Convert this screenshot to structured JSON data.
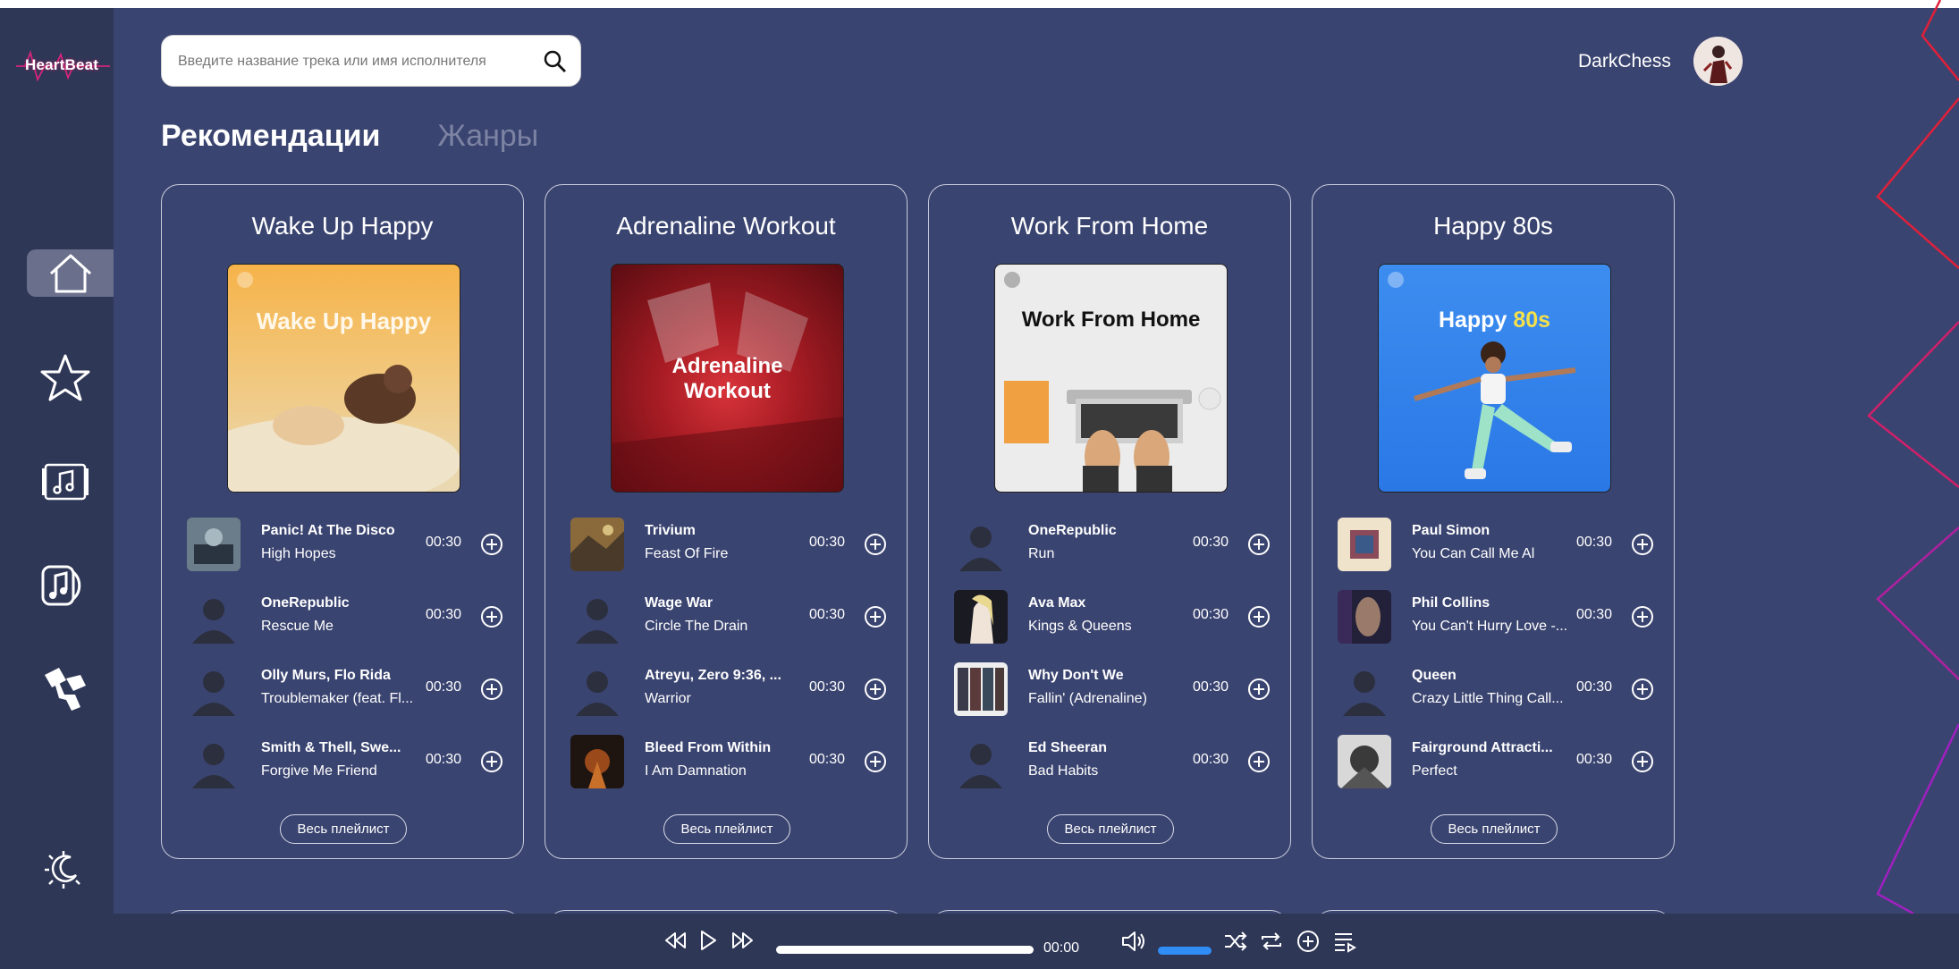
{
  "app": {
    "name": "HeartBeat"
  },
  "search": {
    "placeholder": "Введите название трека или имя исполнителя"
  },
  "user": {
    "name": "DarkChess"
  },
  "tabs": [
    {
      "label": "Рекомендации",
      "active": true
    },
    {
      "label": "Жанры",
      "active": false
    }
  ],
  "sidebar": {
    "items": [
      "home-icon",
      "star-icon",
      "music-album-icon",
      "music-note-icon",
      "microphone-icon",
      "theme-toggle-icon"
    ]
  },
  "playlists": [
    {
      "title": "Wake Up Happy",
      "cover_text": "Wake Up Happy",
      "tracks": [
        {
          "artist": "Panic! At The Disco",
          "song": "High Hopes",
          "duration": "00:30"
        },
        {
          "artist": "OneRepublic",
          "song": "Rescue Me",
          "duration": "00:30"
        },
        {
          "artist": "Olly Murs, Flo Rida",
          "song": "Troublemaker (feat. Fl...",
          "duration": "00:30"
        },
        {
          "artist": "Smith & Thell, Swe...",
          "song": "Forgive Me Friend",
          "duration": "00:30"
        }
      ],
      "button": "Весь плейлист"
    },
    {
      "title": "Adrenaline Workout",
      "cover_text": "Adrenaline Workout",
      "tracks": [
        {
          "artist": "Trivium",
          "song": "Feast Of Fire",
          "duration": "00:30"
        },
        {
          "artist": "Wage War",
          "song": "Circle The Drain",
          "duration": "00:30"
        },
        {
          "artist": "Atreyu, Zero 9:36, ...",
          "song": "Warrior",
          "duration": "00:30"
        },
        {
          "artist": "Bleed From Within",
          "song": "I Am Damnation",
          "duration": "00:30"
        }
      ],
      "button": "Весь плейлист"
    },
    {
      "title": "Work From Home",
      "cover_text": "Work From Home",
      "tracks": [
        {
          "artist": "OneRepublic",
          "song": "Run",
          "duration": "00:30"
        },
        {
          "artist": "Ava Max",
          "song": "Kings & Queens",
          "duration": "00:30"
        },
        {
          "artist": "Why Don't We",
          "song": "Fallin' (Adrenaline)",
          "duration": "00:30"
        },
        {
          "artist": "Ed Sheeran",
          "song": "Bad Habits",
          "duration": "00:30"
        }
      ],
      "button": "Весь плейлист"
    },
    {
      "title": "Happy 80s",
      "cover_text_a": "Happy",
      "cover_text_b": "80s",
      "tracks": [
        {
          "artist": "Paul Simon",
          "song": "You Can Call Me Al",
          "duration": "00:30"
        },
        {
          "artist": "Phil Collins",
          "song": "You Can't Hurry Love -...",
          "duration": "00:30"
        },
        {
          "artist": "Queen",
          "song": "Crazy Little Thing Call...",
          "duration": "00:30"
        },
        {
          "artist": "Fairground Attracti...",
          "song": "Perfect",
          "duration": "00:30"
        }
      ],
      "button": "Весь плейлист"
    }
  ],
  "player": {
    "time": "00:00",
    "progress": 1.0,
    "volume": 1.0
  },
  "colors": {
    "background": "#3a4470",
    "sidebar": "#2f3757",
    "accent": "#2f8df5",
    "deco_red": "#e0203a",
    "deco_purple": "#a020c0"
  }
}
